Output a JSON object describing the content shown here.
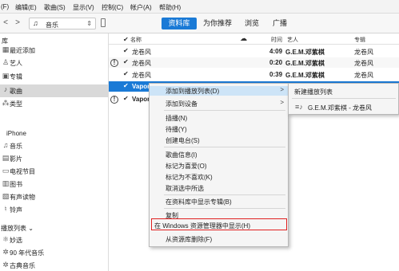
{
  "menubar": {
    "items": [
      "(F)",
      "编辑(E)",
      "歌曲(S)",
      "显示(V)",
      "控制(C)",
      "帐户(A)",
      "帮助(H)"
    ]
  },
  "toolbar": {
    "back": "<",
    "forward": ">",
    "media_kind": "音乐",
    "tabs": [
      "资料库",
      "为你推荐",
      "浏览",
      "广播"
    ],
    "active_tab": "资料库"
  },
  "sidebar": {
    "library_header": "库",
    "library_items": [
      {
        "label": "最近添加",
        "icon": "recent-icon"
      },
      {
        "label": "艺人",
        "icon": "artist-icon"
      },
      {
        "label": "专辑",
        "icon": "album-icon"
      },
      {
        "label": "歌曲",
        "icon": "song-icon",
        "selected": true
      },
      {
        "label": "类型",
        "icon": "genre-icon"
      }
    ],
    "device_header": "iPhone",
    "device_items": [
      {
        "label": "音乐",
        "icon": "music-icon"
      },
      {
        "label": "影片",
        "icon": "film-icon"
      },
      {
        "label": "电视节目",
        "icon": "tv-icon"
      },
      {
        "label": "图书",
        "icon": "book-icon"
      },
      {
        "label": "有声读物",
        "icon": "audiobook-icon"
      },
      {
        "label": "铃声",
        "icon": "bell-icon"
      }
    ],
    "playlist_header": "播放列表 ⌄",
    "playlist_items": [
      {
        "label": "妙选",
        "icon": "genius-icon"
      },
      {
        "label": "90 年代音乐",
        "icon": "gear-icon"
      },
      {
        "label": "古典音乐",
        "icon": "gear-icon"
      }
    ]
  },
  "table": {
    "columns": {
      "name": "名称",
      "time": "时间",
      "artist": "艺人",
      "album": "专辑"
    },
    "rows": [
      {
        "alert": false,
        "name": "龙卷风",
        "time": "4:09",
        "artist": "G.E.M.邓紫棋",
        "album": "龙卷风"
      },
      {
        "alert": true,
        "name": "龙卷风",
        "time": "0:20",
        "artist": "G.E.M.邓紫棋",
        "album": "龙卷风"
      },
      {
        "alert": false,
        "name": "龙卷风",
        "time": "0:39",
        "artist": "G.E.M.邓紫棋",
        "album": "龙卷风"
      },
      {
        "alert": false,
        "name": "Vapor",
        "time": "",
        "artist": "",
        "album": "",
        "selected": true
      },
      {
        "alert": true,
        "name": "Vapor",
        "time": "",
        "artist": "",
        "album": ""
      }
    ]
  },
  "context_menu": {
    "items": [
      {
        "label": "添加到播放列表(D)",
        "submenu": true,
        "highlight": true
      },
      {
        "label": "添加到设备",
        "submenu": true
      },
      {
        "label": "插播(N)"
      },
      {
        "label": "待播(Y)"
      },
      {
        "label": "创建电台(S)"
      },
      {
        "label": "歌曲信息(I)"
      },
      {
        "label": "标记为喜爱(O)"
      },
      {
        "label": "标记为不喜欢(K)"
      },
      {
        "label": "取消选中所选"
      },
      {
        "label": "在资料库中显示专辑(B)"
      },
      {
        "label": "复制"
      },
      {
        "label": "在 Windows 资源管理器中显示(H)",
        "outlined": true
      },
      {
        "label": "从资源库删除(F)"
      }
    ],
    "submenu_arrow": ">"
  },
  "submenu": {
    "new_playlist": "新建播放列表",
    "playlist": "G.E.M.邓紫棋 - 龙卷风"
  },
  "colors": {
    "accent": "#1a7ad6",
    "highlight": "#cde4f7",
    "outline": "#e02020"
  }
}
